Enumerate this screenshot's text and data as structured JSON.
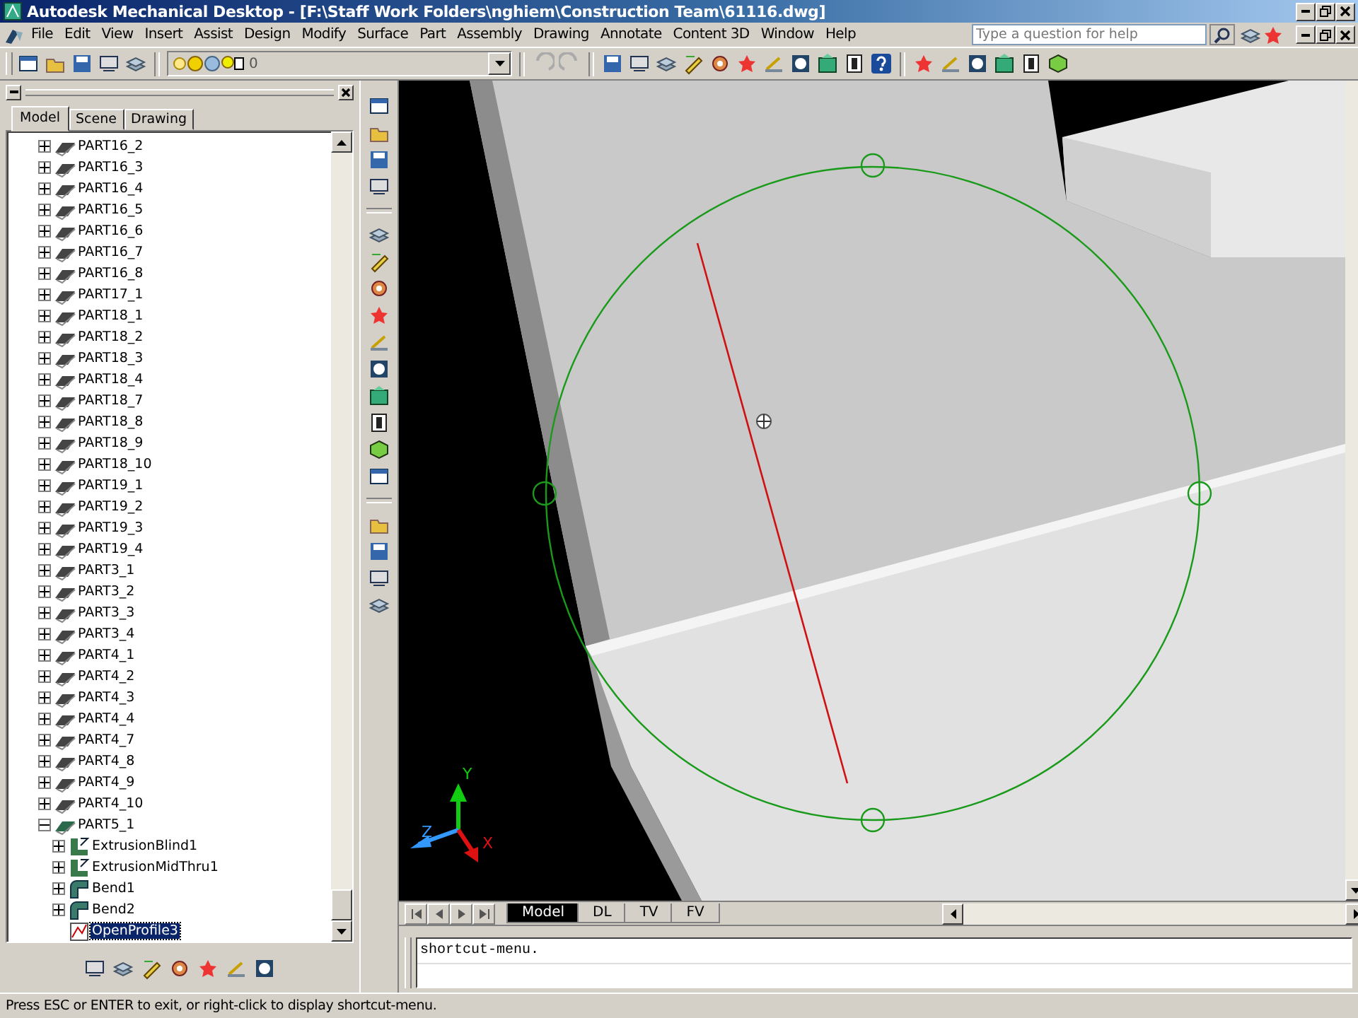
{
  "window": {
    "title": "Autodesk Mechanical Desktop - [F:\\Staff Work Folders\\nghiem\\Construction Team\\61116.dwg]"
  },
  "menu": [
    "File",
    "Edit",
    "View",
    "Insert",
    "Assist",
    "Design",
    "Modify",
    "Surface",
    "Part",
    "Assembly",
    "Drawing",
    "Annotate",
    "Content 3D",
    "Window",
    "Help"
  ],
  "help_search": {
    "placeholder": "Type a question for help"
  },
  "layer_combo": {
    "value": "0"
  },
  "browser": {
    "tabs": [
      {
        "label": "Model",
        "selected": true
      },
      {
        "label": "Scene",
        "selected": false
      },
      {
        "label": "Drawing",
        "selected": false
      }
    ],
    "tree": [
      {
        "label": "PART16_2",
        "expanded": false,
        "selected": false
      },
      {
        "label": "PART16_3",
        "expanded": false,
        "selected": false
      },
      {
        "label": "PART16_4",
        "expanded": false,
        "selected": false
      },
      {
        "label": "PART16_5",
        "expanded": false,
        "selected": false
      },
      {
        "label": "PART16_6",
        "expanded": false,
        "selected": false
      },
      {
        "label": "PART16_7",
        "expanded": false,
        "selected": false
      },
      {
        "label": "PART16_8",
        "expanded": false,
        "selected": false
      },
      {
        "label": "PART17_1",
        "expanded": false,
        "selected": false
      },
      {
        "label": "PART18_1",
        "expanded": false,
        "selected": false
      },
      {
        "label": "PART18_2",
        "expanded": false,
        "selected": false
      },
      {
        "label": "PART18_3",
        "expanded": false,
        "selected": false
      },
      {
        "label": "PART18_4",
        "expanded": false,
        "selected": false
      },
      {
        "label": "PART18_7",
        "expanded": false,
        "selected": false
      },
      {
        "label": "PART18_8",
        "expanded": false,
        "selected": false
      },
      {
        "label": "PART18_9",
        "expanded": false,
        "selected": false
      },
      {
        "label": "PART18_10",
        "expanded": false,
        "selected": false
      },
      {
        "label": "PART19_1",
        "expanded": false,
        "selected": false
      },
      {
        "label": "PART19_2",
        "expanded": false,
        "selected": false
      },
      {
        "label": "PART19_3",
        "expanded": false,
        "selected": false
      },
      {
        "label": "PART19_4",
        "expanded": false,
        "selected": false
      },
      {
        "label": "PART3_1",
        "expanded": false,
        "selected": false
      },
      {
        "label": "PART3_2",
        "expanded": false,
        "selected": false
      },
      {
        "label": "PART3_3",
        "expanded": false,
        "selected": false
      },
      {
        "label": "PART3_4",
        "expanded": false,
        "selected": false
      },
      {
        "label": "PART4_1",
        "expanded": false,
        "selected": false
      },
      {
        "label": "PART4_2",
        "expanded": false,
        "selected": false
      },
      {
        "label": "PART4_3",
        "expanded": false,
        "selected": false
      },
      {
        "label": "PART4_4",
        "expanded": false,
        "selected": false
      },
      {
        "label": "PART4_7",
        "expanded": false,
        "selected": false
      },
      {
        "label": "PART4_8",
        "expanded": false,
        "selected": false
      },
      {
        "label": "PART4_9",
        "expanded": false,
        "selected": false
      },
      {
        "label": "PART4_10",
        "expanded": false,
        "selected": false
      },
      {
        "label": "PART5_1",
        "expanded": true,
        "selected": false,
        "children": [
          {
            "label": "ExtrusionBlind1",
            "kind": "extrusion",
            "expanded": false,
            "selected": false
          },
          {
            "label": "ExtrusionMidThru1",
            "kind": "extrusion",
            "expanded": false,
            "selected": false
          },
          {
            "label": "Bend1",
            "kind": "bend",
            "expanded": false,
            "selected": false
          },
          {
            "label": "Bend2",
            "kind": "bend",
            "expanded": false,
            "selected": false
          },
          {
            "label": "OpenProfile3",
            "kind": "profile",
            "selected": true
          }
        ]
      }
    ]
  },
  "viewport": {
    "ucs": {
      "x": "X",
      "y": "Y",
      "z": "Z"
    },
    "layout_tabs": [
      {
        "label": "Model",
        "selected": true
      },
      {
        "label": "DL",
        "selected": false
      },
      {
        "label": "TV",
        "selected": false
      },
      {
        "label": "FV",
        "selected": false
      }
    ]
  },
  "command_line": {
    "text": "shortcut-menu."
  },
  "status_bar": {
    "text": "Press ESC or ENTER to exit, or right-click to display shortcut-menu."
  }
}
